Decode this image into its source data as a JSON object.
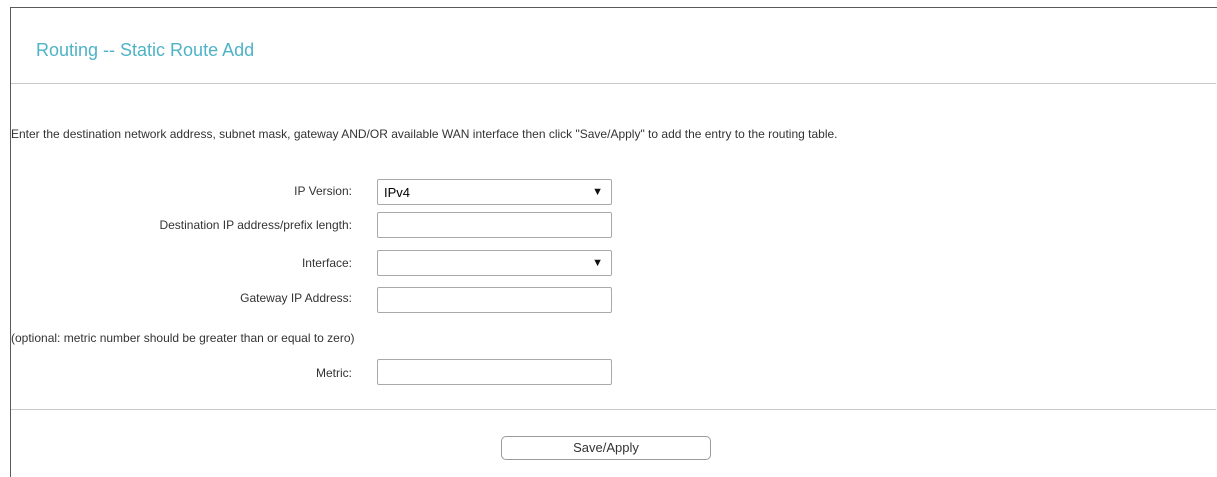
{
  "page": {
    "title": "Routing -- Static Route Add",
    "instructions": "Enter the destination network address, subnet mask, gateway AND/OR available WAN interface then click \"Save/Apply\" to add the entry to the routing table."
  },
  "form": {
    "ip_version": {
      "label": "IP Version:",
      "value": "IPv4",
      "icon": "chevron-down-icon"
    },
    "destination": {
      "label": "Destination IP address/prefix length:",
      "value": ""
    },
    "interface": {
      "label": "Interface:",
      "value": "",
      "icon": "chevron-down-icon"
    },
    "gateway": {
      "label": "Gateway IP Address:",
      "value": ""
    },
    "metric_note": "(optional: metric number should be greater than or equal to zero)",
    "metric": {
      "label": "Metric:",
      "value": ""
    }
  },
  "actions": {
    "save_label": "Save/Apply"
  },
  "colors": {
    "title": "#4eb3c7",
    "text": "#333333",
    "divider": "#c8c8c8",
    "frame_border": "#5a5a5a"
  }
}
